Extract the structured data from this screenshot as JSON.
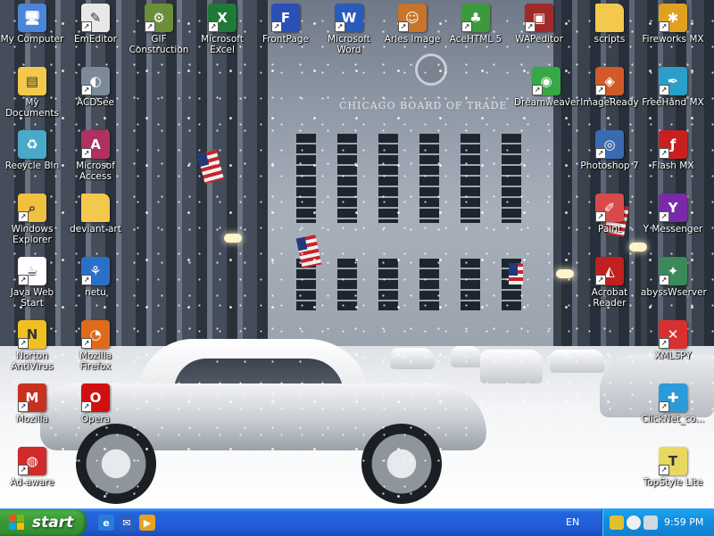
{
  "desktop": {
    "icons": [
      {
        "label": "My Computer",
        "icon": "my-computer-icon",
        "color": "#4a86d8",
        "glyph": "🖥"
      },
      {
        "label": "EmEditor",
        "icon": "emeditor-icon",
        "color": "#e8e8e8",
        "glyph": "✎"
      },
      {
        "label": "GIF\nConstruction",
        "icon": "gif-construction-icon",
        "color": "#6b8e3a",
        "glyph": "⚙"
      },
      {
        "label": "Microsoft\nExcel",
        "icon": "excel-icon",
        "color": "#1f7a3a",
        "glyph": "X"
      },
      {
        "label": "FrontPage",
        "icon": "frontpage-icon",
        "color": "#2a4fb5",
        "glyph": "F"
      },
      {
        "label": "Microsoft\nWord",
        "icon": "word-icon",
        "color": "#2b5bb8",
        "glyph": "W"
      },
      {
        "label": "Arles Image",
        "icon": "arles-image-icon",
        "color": "#c8742a",
        "glyph": "☺"
      },
      {
        "label": "AceHTML 5",
        "icon": "acehtml-icon",
        "color": "#3c9a3c",
        "glyph": "♣"
      },
      {
        "label": "WAPeditor",
        "icon": "wapeditor-icon",
        "color": "#a02a2a",
        "glyph": "▣"
      },
      {
        "label": "scripts",
        "icon": "folder-icon",
        "color": "#f2c94c",
        "glyph": ""
      },
      {
        "label": "Fireworks MX",
        "icon": "fireworks-icon",
        "color": "#e0a020",
        "glyph": "✱"
      },
      {
        "label": "My\nDocuments",
        "icon": "my-documents-icon",
        "color": "#f2c94c",
        "glyph": "▤"
      },
      {
        "label": "ACDSee",
        "icon": "acdsee-icon",
        "color": "#7a8a99",
        "glyph": "◐"
      },
      {
        "label": "Dreamweaver",
        "icon": "dreamweaver-icon",
        "color": "#36a844",
        "glyph": "◉"
      },
      {
        "label": "ImageReady",
        "icon": "imageready-icon",
        "color": "#d05a2a",
        "glyph": "◈"
      },
      {
        "label": "FreeHand MX",
        "icon": "freehand-icon",
        "color": "#2a9fc8",
        "glyph": "✒"
      },
      {
        "label": "Recycle Bin",
        "icon": "recycle-bin-icon",
        "color": "#4aa8c8",
        "glyph": "♻"
      },
      {
        "label": "Microsof\nAccess",
        "icon": "access-icon",
        "color": "#b03060",
        "glyph": "A"
      },
      {
        "label": "Photoshop 7",
        "icon": "photoshop-icon",
        "color": "#3a6ab0",
        "glyph": "◎"
      },
      {
        "label": "Flash MX",
        "icon": "flash-icon",
        "color": "#c82020",
        "glyph": "ƒ"
      },
      {
        "label": "Windows\nExplorer",
        "icon": "windows-explorer-icon",
        "color": "#f0c040",
        "glyph": "⌕"
      },
      {
        "label": "deviant art",
        "icon": "folder-icon",
        "color": "#f2c94c",
        "glyph": ""
      },
      {
        "label": "Paint",
        "icon": "paint-icon",
        "color": "#d84a4a",
        "glyph": "✐"
      },
      {
        "label": "Y Messenger",
        "icon": "yahoo-messenger-icon",
        "color": "#7a2aa8",
        "glyph": "Y"
      },
      {
        "label": "Java Web\nStart",
        "icon": "java-icon",
        "color": "#ffffff",
        "glyph": "☕"
      },
      {
        "label": "netu",
        "icon": "network-icon",
        "color": "#2a70c8",
        "glyph": "⚘"
      },
      {
        "label": "Acrobat\nReader",
        "icon": "acrobat-icon",
        "color": "#c02020",
        "glyph": "◭"
      },
      {
        "label": "abyssWserver",
        "icon": "abyss-web-server-icon",
        "color": "#3a8a5a",
        "glyph": "✦"
      },
      {
        "label": "Norton\nAntiVirus",
        "icon": "norton-antivirus-icon",
        "color": "#f0c020",
        "glyph": "N"
      },
      {
        "label": "Mozilla Firefox",
        "icon": "firefox-icon",
        "color": "#e06a1a",
        "glyph": "◔"
      },
      {
        "label": "XMLSPY",
        "icon": "xmlspy-icon",
        "color": "#d83030",
        "glyph": "✕"
      },
      {
        "label": "Mozilla",
        "icon": "mozilla-icon",
        "color": "#c83020",
        "glyph": "M"
      },
      {
        "label": "Opera",
        "icon": "opera-icon",
        "color": "#d01010",
        "glyph": "O"
      },
      {
        "label": "ClickNet_co...",
        "icon": "clicknet-icon",
        "color": "#2a9ad8",
        "glyph": "✚"
      },
      {
        "label": "Ad-aware",
        "icon": "ad-aware-icon",
        "color": "#d02a2a",
        "glyph": "◍"
      },
      {
        "label": "TopStyle Lite",
        "icon": "topstyle-icon",
        "color": "#e8d860",
        "glyph": "T"
      }
    ],
    "wallpaper_sign": "CHICAGO BOARD OF TRADE"
  },
  "taskbar": {
    "start_label": "start",
    "quick_launch": [
      {
        "icon": "internet-explorer-icon",
        "color": "#2a7ad8",
        "glyph": "e"
      },
      {
        "icon": "outlook-express-icon",
        "color": "#2a5fc0",
        "glyph": "✉"
      },
      {
        "icon": "media-player-icon",
        "color": "#e8a020",
        "glyph": "▶"
      }
    ],
    "language": "EN",
    "tray_icons": [
      {
        "icon": "network-tray-icon",
        "color": "#e0c030"
      },
      {
        "icon": "messenger-tray-icon",
        "color": "#f0f0f0"
      },
      {
        "icon": "volume-tray-icon",
        "color": "#d0d8e0"
      }
    ],
    "clock": "9:59 PM"
  }
}
